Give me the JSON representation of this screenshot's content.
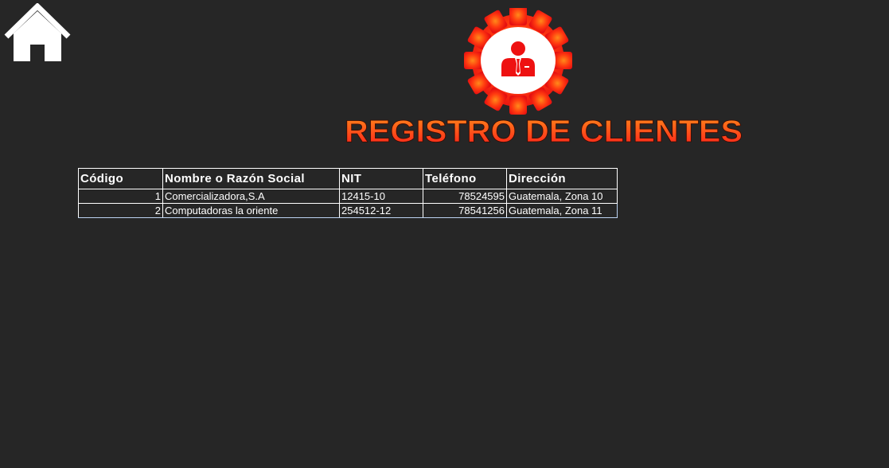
{
  "nav": {
    "home_icon": "home-icon"
  },
  "header": {
    "logo_icon": "gear-user-icon",
    "title": "REGISTRO DE CLIENTES",
    "title_gradient": [
      "#ff1a1a",
      "#ff8a1a"
    ]
  },
  "table": {
    "columns": [
      "Código",
      "Nombre o Razón Social",
      "NIT",
      "Teléfono",
      "Dirección"
    ],
    "rows": [
      [
        "1",
        "Comercializadora,S.A",
        "12415-10",
        "78524595",
        "Guatemala, Zona 10"
      ],
      [
        "2",
        "Computadoras la oriente",
        "254512-12",
        "78541256",
        "Guatemala, Zona 11"
      ]
    ]
  },
  "colors": {
    "background": "#262626",
    "accent": "#ff2a14",
    "text": "#ffffff"
  }
}
